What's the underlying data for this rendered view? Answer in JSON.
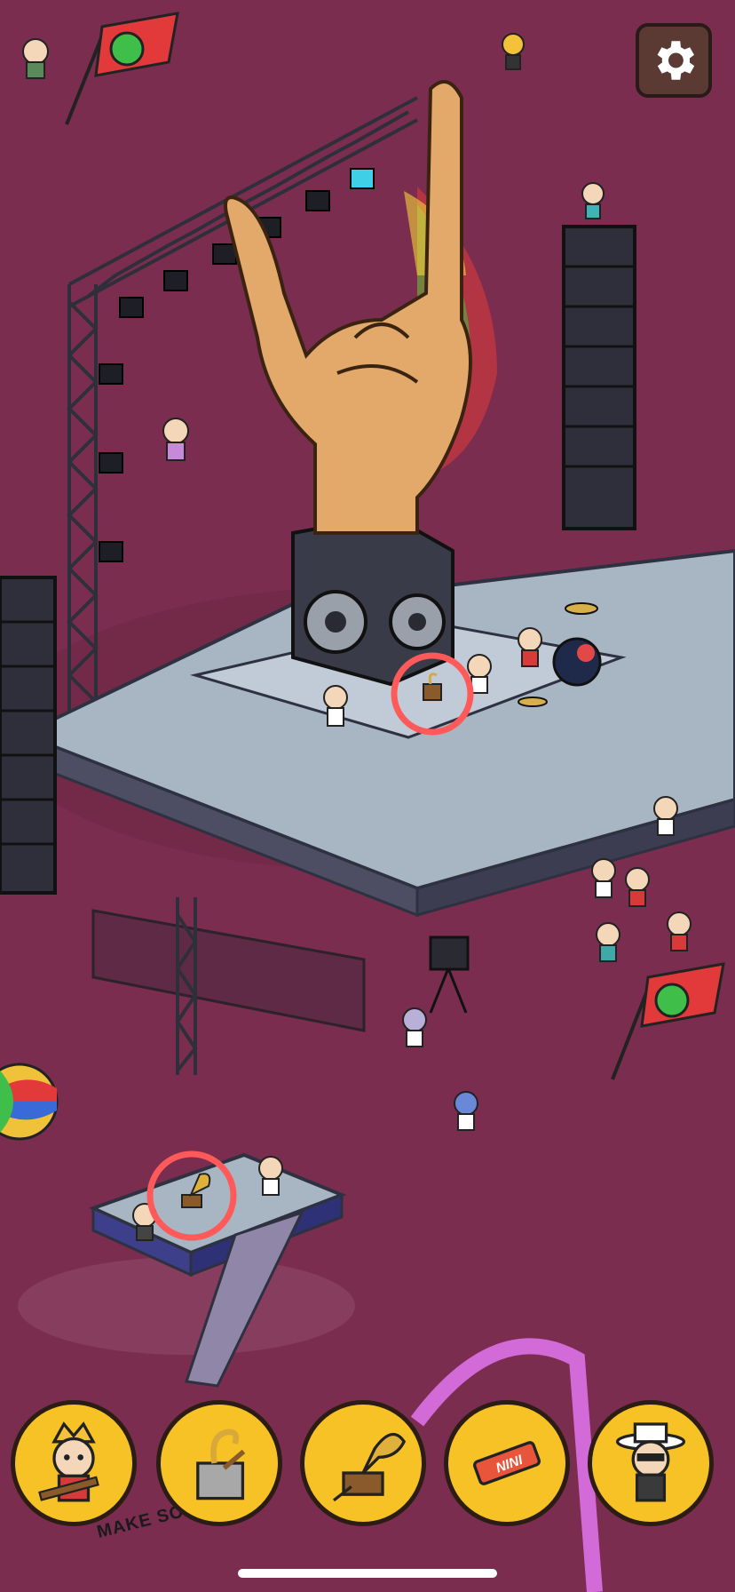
{
  "game": {
    "scene": "festival-stage",
    "colors": {
      "background": "#7a2d4f",
      "slot": "#f6c226",
      "found_marker": "#ff5a5a"
    }
  },
  "hud": {
    "settings_icon": "gear-icon"
  },
  "found_markers": [
    {
      "item": "saxophone-case"
    },
    {
      "item": "gramophone"
    }
  ],
  "item_tray": [
    {
      "icon": "rocker-girl-with-guitar-icon"
    },
    {
      "icon": "saxophone-case-icon"
    },
    {
      "icon": "gramophone-icon"
    },
    {
      "icon": "nini-wristband-icon",
      "label": "NINI"
    },
    {
      "icon": "girl-with-white-hat-and-sunglasses-icon"
    }
  ],
  "signage": {
    "banner_text": "MAKE SOM"
  }
}
